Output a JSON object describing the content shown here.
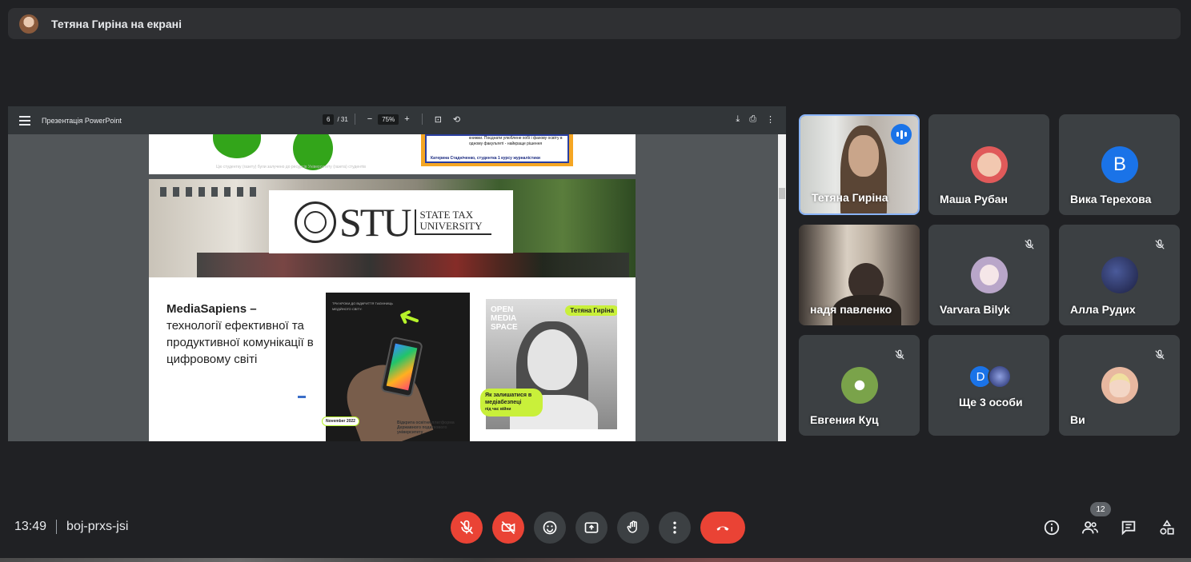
{
  "banner": {
    "text": "Тетяна Гиріна на екрані"
  },
  "pdf": {
    "title": "Презентація PowerPoint",
    "page_current": "6",
    "page_total": "/ 31",
    "zoom": "75%",
    "top_quote": "книжки. Поєднати улюблене хобі і фахову освіту в одному факультеті - найкраще рішення",
    "top_quote_name": "Катерина Стадніченко, студентка 1 курсу журналістики",
    "top_caption": "Цю студентку (газету) були залучено до ресурсів Університету (газета) студентів",
    "logo_letters": "STU",
    "logo_words": "STATE TAX UNIVERSITY",
    "ms_title": "MediaSapiens –",
    "ms_body": "технології ефективної та продуктивної комунікації в цифровому світі",
    "poster1_lines": "ТРИ КРОКИ ДО ВІДКРИТТЯ ТАЄМНИЦЬ МЕДІЙНОГО СВІТУ:",
    "poster1_date": "November 2022",
    "poster1_footer": "Відкрита освітня платформа Державного податкового університету",
    "poster2_brand": "OPEN MEDIA SPACE",
    "poster2_name": "Тетяна Гиріна",
    "poster2_tag": "Як залишатися в медіабезпеці",
    "poster2_tag_small": "під час війни"
  },
  "participants": [
    {
      "name": "Тетяна Гиріна",
      "type": "camera",
      "speaking": true
    },
    {
      "name": "Маша Рубан",
      "type": "avatar",
      "avatar_color": "#e05a5a"
    },
    {
      "name": "Вика Терехова",
      "type": "letter",
      "letter": "В",
      "avatar_color": "#1a73e8"
    },
    {
      "name": "надя павленко",
      "type": "camera"
    },
    {
      "name": "Varvara Bilyk",
      "type": "avatar",
      "muted": true,
      "avatar_color": "#b9a6c9"
    },
    {
      "name": "Алла Рудих",
      "type": "avatar",
      "muted": true,
      "avatar_color": "#2c2f5a"
    },
    {
      "name": "Евгения Куц",
      "type": "avatar",
      "muted": true,
      "avatar_color": "#6a8f3a"
    },
    {
      "name": "Ще 3 особи",
      "type": "group",
      "letter": "D",
      "avatar_color": "#1a73e8"
    },
    {
      "name": "Ви",
      "type": "avatar",
      "muted": true,
      "avatar_color": "#e8b8a0"
    }
  ],
  "meeting": {
    "time": "13:49",
    "code": "boj-prxs-jsi",
    "people_count": "12"
  },
  "colors": {
    "background": "#202124",
    "tile": "#3c4043",
    "red": "#ea4335",
    "active_border": "#8ab4f8"
  }
}
